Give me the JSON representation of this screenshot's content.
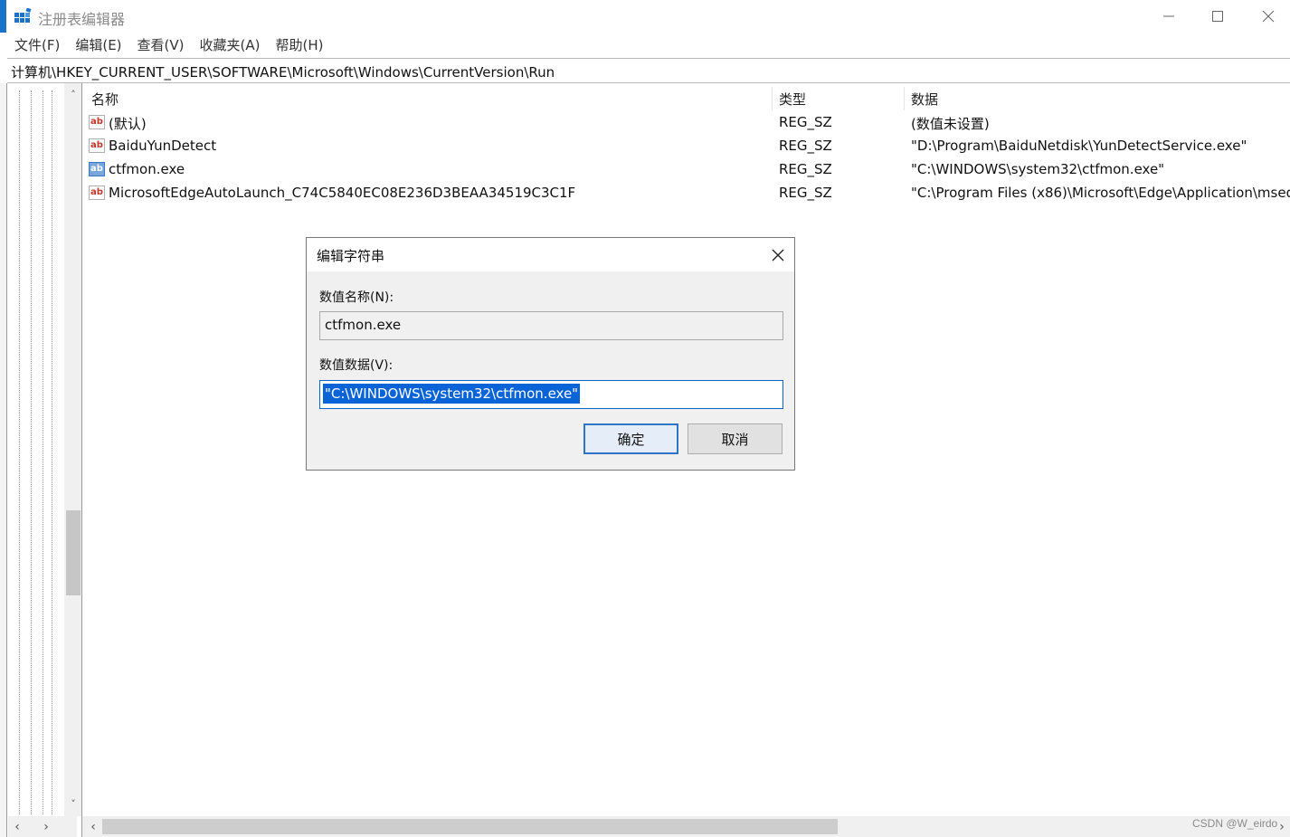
{
  "window": {
    "title": "注册表编辑器",
    "controls": {
      "minimize": "minimize",
      "maximize": "maximize",
      "close": "close"
    }
  },
  "menu": {
    "items": [
      "文件(F)",
      "编辑(E)",
      "查看(V)",
      "收藏夹(A)",
      "帮助(H)"
    ]
  },
  "address": {
    "path": "计算机\\HKEY_CURRENT_USER\\SOFTWARE\\Microsoft\\Windows\\CurrentVersion\\Run"
  },
  "list": {
    "columns": {
      "name": "名称",
      "type": "类型",
      "data": "数据"
    },
    "rows": [
      {
        "name": "(默认)",
        "type": "REG_SZ",
        "data": "(数值未设置)",
        "icon": "string-value-icon"
      },
      {
        "name": "BaiduYunDetect",
        "type": "REG_SZ",
        "data": "\"D:\\Program\\BaiduNetdisk\\YunDetectService.exe\"",
        "icon": "string-value-icon"
      },
      {
        "name": "ctfmon.exe",
        "type": "REG_SZ",
        "data": "\"C:\\WINDOWS\\system32\\ctfmon.exe\"",
        "icon": "string-value-icon",
        "selected": true
      },
      {
        "name": "MicrosoftEdgeAutoLaunch_C74C5840EC08E236D3BEAA34519C3C1F",
        "type": "REG_SZ",
        "data": "\"C:\\Program Files (x86)\\Microsoft\\Edge\\Application\\msedg",
        "icon": "string-value-icon"
      }
    ],
    "icon_glyph": "ab"
  },
  "dialog": {
    "title": "编辑字符串",
    "name_label": "数值名称(N):",
    "name_value": "ctfmon.exe",
    "data_label": "数值数据(V):",
    "data_value": "\"C:\\WINDOWS\\system32\\ctfmon.exe\"",
    "ok_label": "确定",
    "cancel_label": "取消"
  },
  "watermark": "CSDN @W_eirdo",
  "colors": {
    "selection": "#0a64d8",
    "ok_border": "#2f75c6",
    "accent": "#1a73c8"
  }
}
